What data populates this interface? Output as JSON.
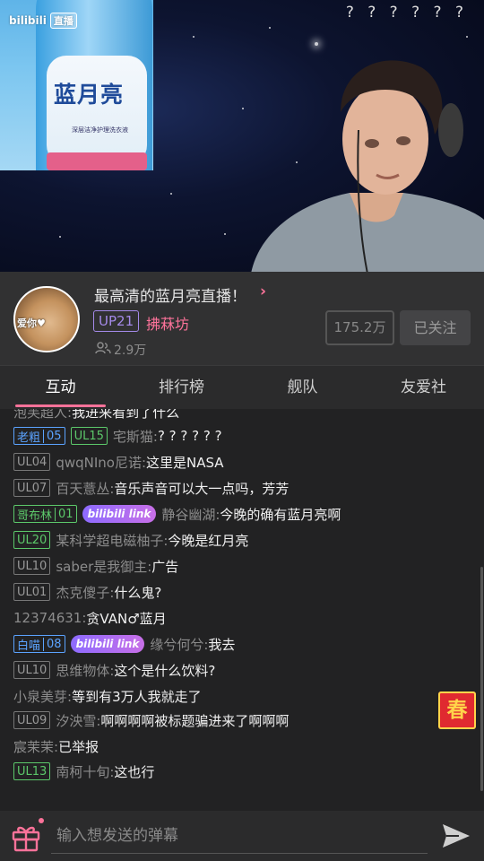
{
  "video": {
    "logo": "bilibili",
    "live_tag": "直播",
    "product_brand": "蓝月亮",
    "product_sub": "深层洁净护理洗衣液",
    "overlay_text": "? ? ? ? ? ?"
  },
  "streamer": {
    "title": "最高清的蓝月亮直播！",
    "title_arrow": ">",
    "avatar_text": "爱你♥",
    "up_level": "UP21",
    "name": "拂菻坊",
    "viewers": "2.9万",
    "fans": "175.2万",
    "follow_label": "已关注"
  },
  "tabs": [
    {
      "label": "互动",
      "active": true
    },
    {
      "label": "排行榜",
      "active": false
    },
    {
      "label": "舰队",
      "active": false
    },
    {
      "label": "友爱社",
      "active": false
    }
  ],
  "chat": [
    {
      "user": "泡芙超人:",
      "text": "我进来看到了什么"
    },
    {
      "medal": "老粗",
      "medal_level": "05",
      "ul": "UL15",
      "ul_color": "green",
      "user": "宅斯猫:",
      "text": "? ? ? ? ? ?"
    },
    {
      "ul": "UL04",
      "user": "qwqNIno尼诺:",
      "text": "这里是NASA"
    },
    {
      "ul": "UL07",
      "user": "百天薏丛:",
      "text": "音乐声音可以大一点吗，芳芳"
    },
    {
      "medal": "哥布林",
      "medal_level": "01",
      "medal_color": "green",
      "link": "bilibili link",
      "user": "静谷幽湖:",
      "text": "今晚的确有蓝月亮啊"
    },
    {
      "ul": "UL20",
      "ul_color": "green",
      "user": "某科学超电磁柚子:",
      "text": "今晚是红月亮"
    },
    {
      "ul": "UL10",
      "user": "saber是我御主:",
      "text": "广告"
    },
    {
      "ul": "UL01",
      "user": "杰克傻子:",
      "text": "什么鬼?"
    },
    {
      "user": "12374631:",
      "text": "贪VAN♂蓝月"
    },
    {
      "medal": "白喵",
      "medal_level": "08",
      "link": "bilibili link",
      "user": "缘兮何兮:",
      "text": "我去"
    },
    {
      "ul": "UL10",
      "user": "思维物体:",
      "text": "这个是什么饮料?"
    },
    {
      "user": "小泉美芽:",
      "text": "等到有3万人我就走了"
    },
    {
      "ul": "UL09",
      "user": "汐泱雪:",
      "text": "啊啊啊啊被标题骗进来了啊啊啊"
    },
    {
      "user": "宸茉茉:",
      "text": "已举报"
    },
    {
      "ul": "UL13",
      "ul_color": "green",
      "user": "南柯十旬:",
      "text": "这也行"
    }
  ],
  "spring_label": "春",
  "input": {
    "placeholder": "输入想发送的弹幕"
  }
}
